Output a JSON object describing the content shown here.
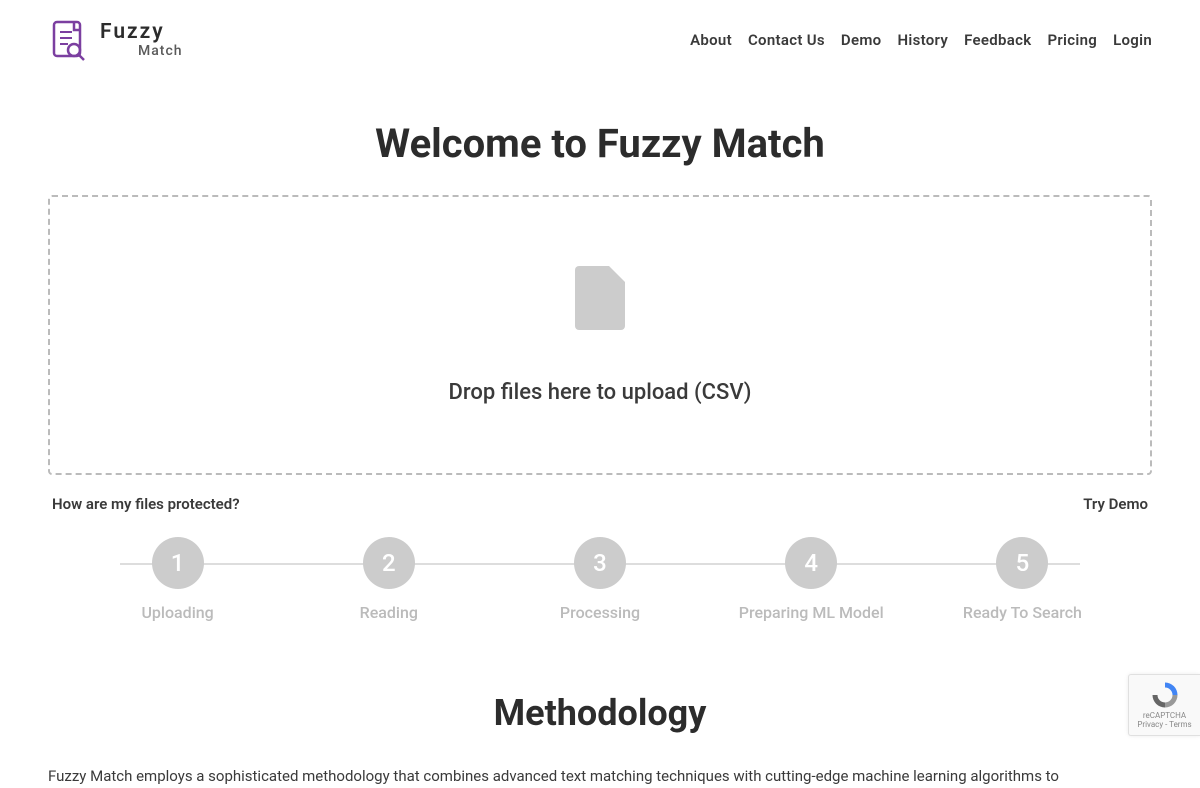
{
  "logo": {
    "main": "Fuzzy",
    "sub": "Match"
  },
  "nav": {
    "about": "About",
    "contact": "Contact Us",
    "demo": "Demo",
    "history": "History",
    "feedback": "Feedback",
    "pricing": "Pricing",
    "login": "Login"
  },
  "welcome_title": "Welcome to Fuzzy Match",
  "dropzone_text": "Drop files here to upload (CSV)",
  "protect_link": "How are my files protected?",
  "demo_link": "Try Demo",
  "steps": [
    {
      "num": "1",
      "label": "Uploading"
    },
    {
      "num": "2",
      "label": "Reading"
    },
    {
      "num": "3",
      "label": "Processing"
    },
    {
      "num": "4",
      "label": "Preparing ML Model"
    },
    {
      "num": "5",
      "label": "Ready To Search"
    }
  ],
  "methodology_title": "Methodology",
  "methodology_body": "Fuzzy Match employs a sophisticated methodology that combines advanced text matching techniques with cutting-edge machine learning algorithms to",
  "recaptcha": {
    "label": "reCAPTCHA",
    "links": "Privacy - Terms"
  }
}
